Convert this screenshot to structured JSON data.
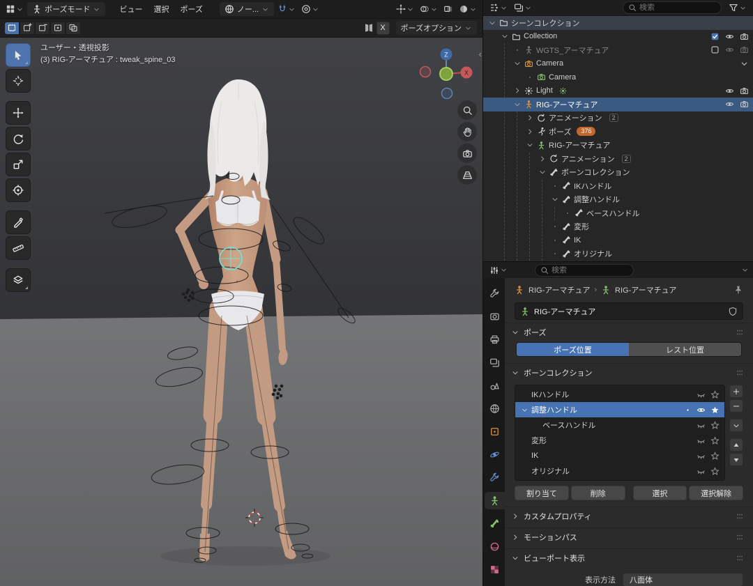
{
  "colors": {
    "accent": "#4772b3",
    "selected_row": "#3b5a82",
    "badge_orange": "#c4672c",
    "cyan_widget": "#6fe3dc",
    "object_orange": "#e0933c",
    "data_green": "#83c16b"
  },
  "topbar": {
    "mode": "ポーズモード",
    "menus": [
      "ビュー",
      "選択",
      "ポーズ"
    ],
    "orientation": "ノー...",
    "mirror_x": "X",
    "pose_options": "ポーズオプション",
    "select_mode_icons": [
      "select-new",
      "select-extend",
      "select-subtract",
      "select-invert",
      "select-intersect"
    ],
    "header_toggles": [
      "show-gizmos",
      "show-overlays",
      "toggle-xray",
      "viewport-shading"
    ]
  },
  "viewport": {
    "overlay_line1": "ユーザー・透視投影",
    "overlay_line2": "(3) RIG-アーマチュア : tweak_spine_03",
    "axis_x": "X",
    "axis_z": "Z",
    "tools": [
      "select-box",
      "cursor",
      "move",
      "rotate",
      "scale",
      "transform",
      "annotate",
      "measure",
      "more-tools"
    ],
    "active_tool_index": 0,
    "nav_buttons": [
      "zoom",
      "pan",
      "camera-view",
      "toggle-ortho"
    ]
  },
  "outliner": {
    "search_placeholder": "検索",
    "rows": [
      {
        "label": "シーンコレクション",
        "indent": 0,
        "arrow": "down",
        "icon": "collection",
        "highlight": true
      },
      {
        "label": "Collection",
        "indent": 1,
        "arrow": "down",
        "icon": "collection",
        "right": [
          "checkbox-on",
          "eye",
          "camera"
        ]
      },
      {
        "label": "WGTS_アーマチュア",
        "indent": 2,
        "arrow": "none",
        "icon": "armature",
        "color": "dim",
        "dim": true,
        "right": [
          "checkbox-off",
          "eye-dim",
          "camera-dim"
        ]
      },
      {
        "label": "Camera",
        "indent": 2,
        "arrow": "down",
        "icon": "camera",
        "color": "orange",
        "right": [
          "chevron"
        ]
      },
      {
        "label": "Camera",
        "indent": 3,
        "arrow": "none",
        "icon": "camera",
        "color": "green"
      },
      {
        "label": "Light",
        "indent": 2,
        "arrow": "right",
        "icon": "light",
        "color": "white",
        "suffix": "light-data",
        "right": [
          "eye",
          "camera"
        ]
      },
      {
        "label": "RIG-アーマチュア",
        "indent": 2,
        "arrow": "down",
        "icon": "armature",
        "color": "orange",
        "selected": true,
        "right": [
          "eye",
          "camera"
        ]
      },
      {
        "label": "アニメーション",
        "indent": 3,
        "arrow": "right",
        "icon": "anim",
        "users": "2"
      },
      {
        "label": "ポーズ",
        "indent": 3,
        "arrow": "right",
        "icon": "pose",
        "badge": "376"
      },
      {
        "label": "RIG-アーマチュア",
        "indent": 3,
        "arrow": "down",
        "icon": "armature",
        "color": "green"
      },
      {
        "label": "アニメーション",
        "indent": 4,
        "arrow": "right",
        "icon": "anim",
        "users": "2"
      },
      {
        "label": "ボーンコレクション",
        "indent": 4,
        "arrow": "down",
        "icon": "bone"
      },
      {
        "label": "IKハンドル",
        "indent": 5,
        "arrow": "none",
        "icon": "bone"
      },
      {
        "label": "調整ハンドル",
        "indent": 5,
        "arrow": "down",
        "icon": "bone"
      },
      {
        "label": "ベースハンドル",
        "indent": 6,
        "arrow": "none",
        "icon": "bone"
      },
      {
        "label": "変形",
        "indent": 5,
        "arrow": "none",
        "icon": "bone"
      },
      {
        "label": "IK",
        "indent": 5,
        "arrow": "none",
        "icon": "bone"
      },
      {
        "label": "オリジナル",
        "indent": 5,
        "arrow": "none",
        "icon": "bone"
      }
    ]
  },
  "properties": {
    "search_placeholder": "検索",
    "tabs": [
      "tool",
      "render",
      "output",
      "view-layer",
      "scene",
      "world",
      "object",
      "physics",
      "constraints",
      "object-data",
      "bone",
      "material",
      "texture"
    ],
    "active_tab": "object-data",
    "breadcrumb_object": "RIG-アーマチュア",
    "breadcrumb_data": "RIG-アーマチュア",
    "name_value": "RIG-アーマチュア",
    "pose": {
      "title": "ポーズ",
      "pose_position": "ポーズ位置",
      "rest_position": "レスト位置"
    },
    "bone_collections": {
      "title": "ボーンコレクション",
      "rows": [
        {
          "label": "IKハンドル",
          "indent": 0
        },
        {
          "label": "調整ハンドル",
          "indent": 0,
          "selected": true,
          "expanded": true
        },
        {
          "label": "ベースハンドル",
          "indent": 1
        },
        {
          "label": "変形",
          "indent": 0
        },
        {
          "label": "IK",
          "indent": 0
        },
        {
          "label": "オリジナル",
          "indent": 0
        }
      ],
      "assign": "割り当て",
      "remove": "削除",
      "select": "選択",
      "deselect": "選択解除"
    },
    "custom_properties": "カスタムプロパティ",
    "motion_paths": "モーションパス",
    "viewport_display": "ビューポート表示",
    "display_as_label": "表示方法",
    "display_as_value": "八面体"
  }
}
